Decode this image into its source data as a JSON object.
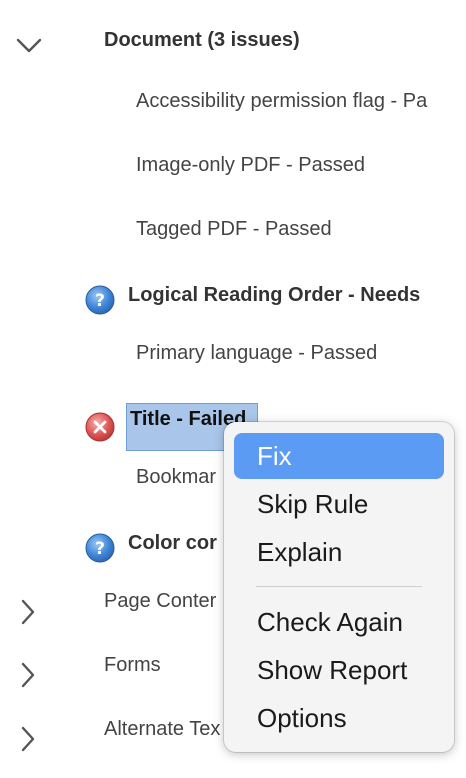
{
  "tree": {
    "document": {
      "label": "Document (3 issues)"
    },
    "doc_items": [
      "Accessibility permission flag - Pa",
      "Image-only PDF - Passed",
      "Tagged PDF - Passed"
    ],
    "logical_reading": "Logical Reading Order - Needs",
    "primary_language": "Primary language - Passed",
    "title_item": "Title - Failed",
    "bookmarks": "Bookmar",
    "color_contrast": "Color cor",
    "sections": [
      "Page Conter",
      "Forms",
      "Alternate Tex"
    ]
  },
  "context_menu": {
    "items_group1": [
      "Fix",
      "Skip Rule",
      "Explain"
    ],
    "items_group2": [
      "Check Again",
      "Show Report",
      "Options"
    ],
    "active": "Fix"
  },
  "colors": {
    "highlight": "#5b9bf3",
    "selection": "#a9c6ea",
    "needs_check_icon": "#3f86d9",
    "failed_icon": "#e05555"
  },
  "icons": {
    "expand": "chevron-down-icon",
    "collapsed": "chevron-right-icon",
    "needs_check": "question-icon",
    "failed": "error-x-icon"
  }
}
